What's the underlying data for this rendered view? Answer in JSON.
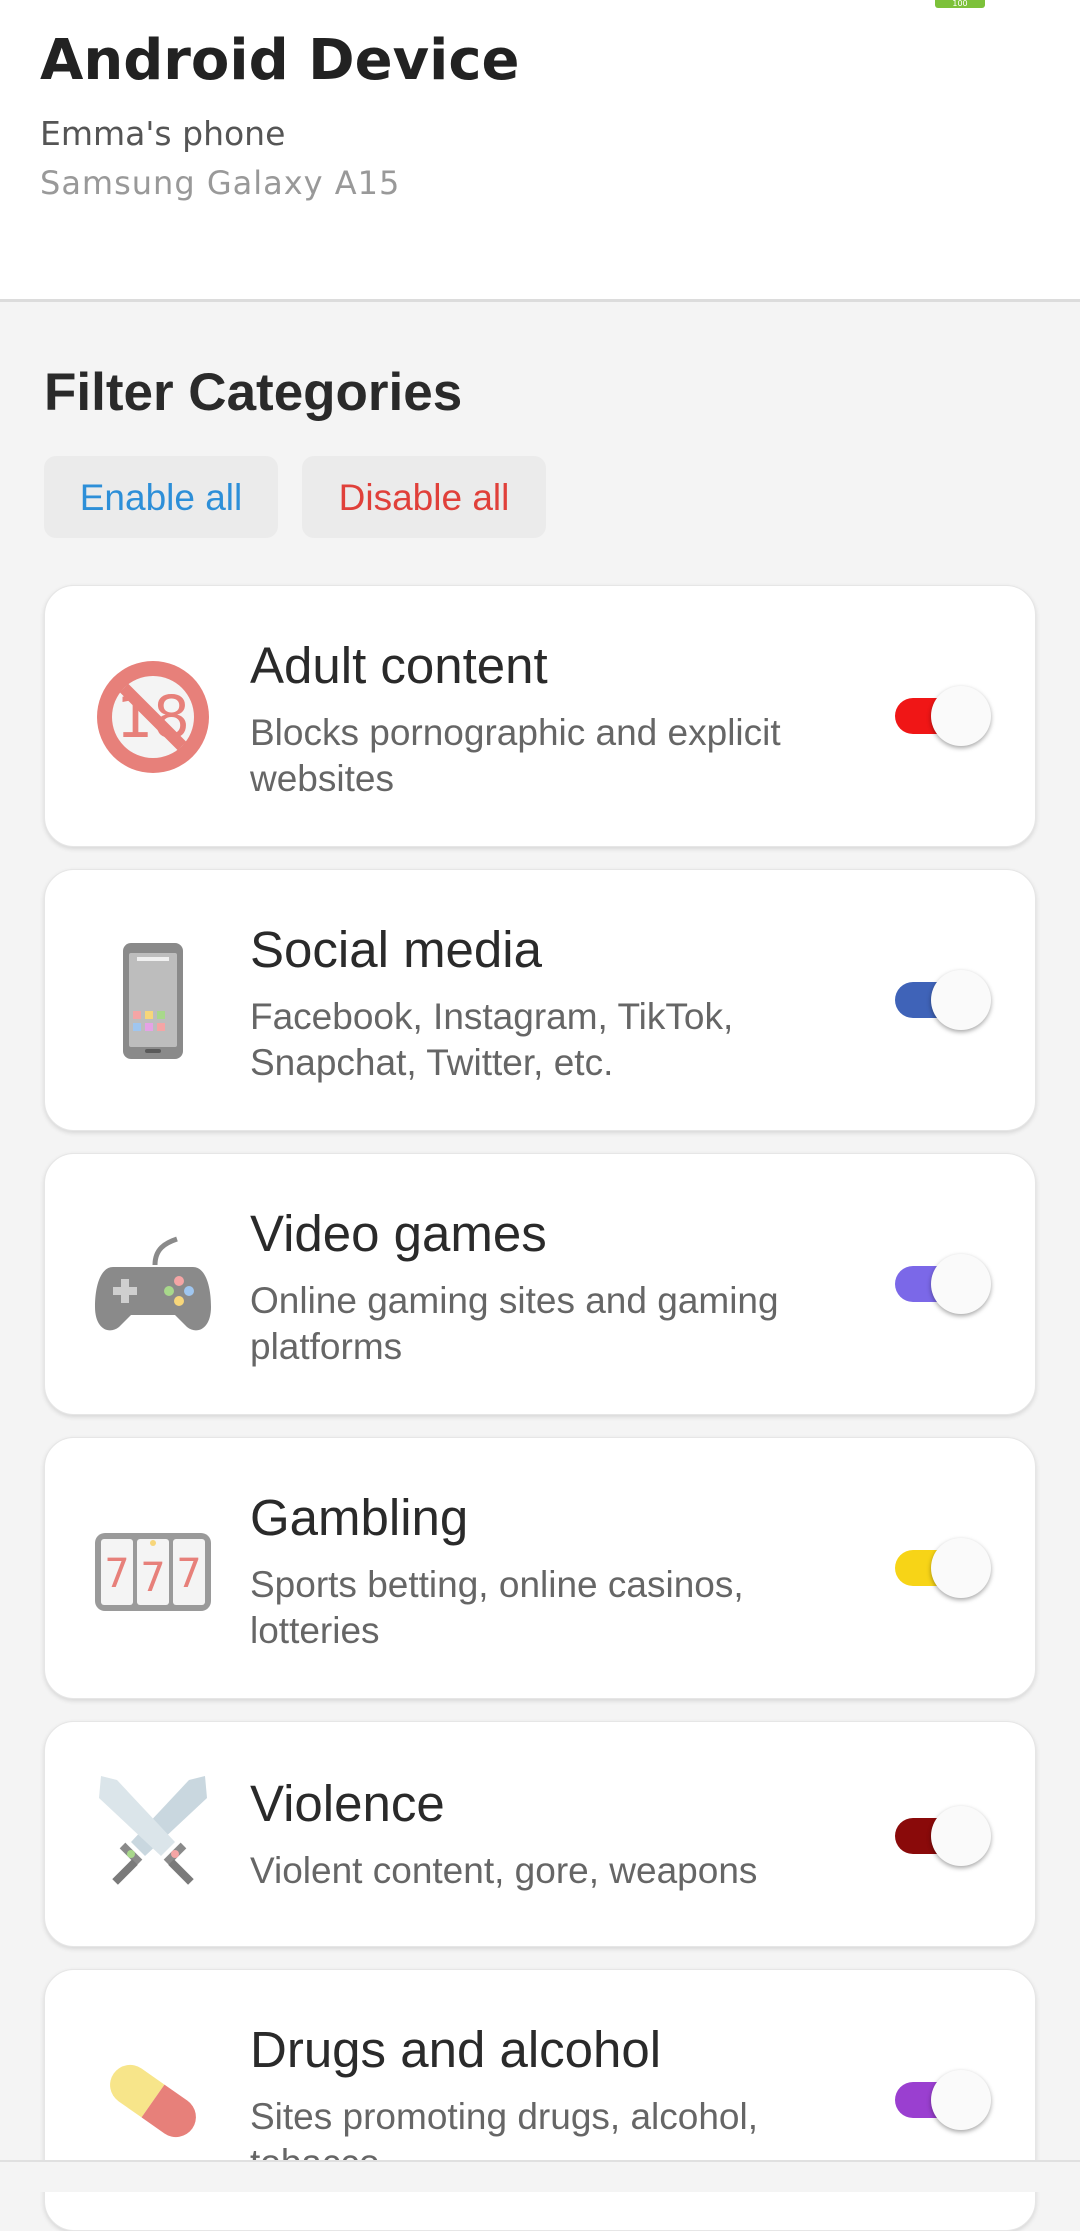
{
  "status": {
    "battery_label": "100"
  },
  "device": {
    "title": "Android Device",
    "name": "Emma's phone",
    "model": "Samsung Galaxy A15"
  },
  "filters": {
    "section_title": "Filter Categories",
    "enable_all_label": "Enable all",
    "disable_all_label": "Disable all",
    "categories": [
      {
        "title": "Adult content",
        "description": "Blocks pornographic and explicit websites",
        "icon": "no-under-18-icon",
        "toggle_color": "#f01616",
        "enabled": true
      },
      {
        "title": "Social media",
        "description": "Facebook, Instagram, TikTok, Snapchat, Twitter, etc.",
        "icon": "mobile-phone-icon",
        "toggle_color": "#3f63b8",
        "enabled": true
      },
      {
        "title": "Video games",
        "description": "Online gaming sites and gaming platforms",
        "icon": "game-controller-icon",
        "toggle_color": "#7b68e8",
        "enabled": true
      },
      {
        "title": "Gambling",
        "description": "Sports betting, online casinos, lotteries",
        "icon": "slot-machine-icon",
        "toggle_color": "#f7d417",
        "enabled": true
      },
      {
        "title": "Violence",
        "description": "Violent content, gore, weapons",
        "icon": "crossed-swords-icon",
        "toggle_color": "#8a0a0a",
        "enabled": true
      },
      {
        "title": "Drugs and alcohol",
        "description": "Sites promoting drugs, alcohol, tobacco",
        "icon": "pill-icon",
        "toggle_color": "#9a3fd0",
        "enabled": true
      }
    ]
  }
}
